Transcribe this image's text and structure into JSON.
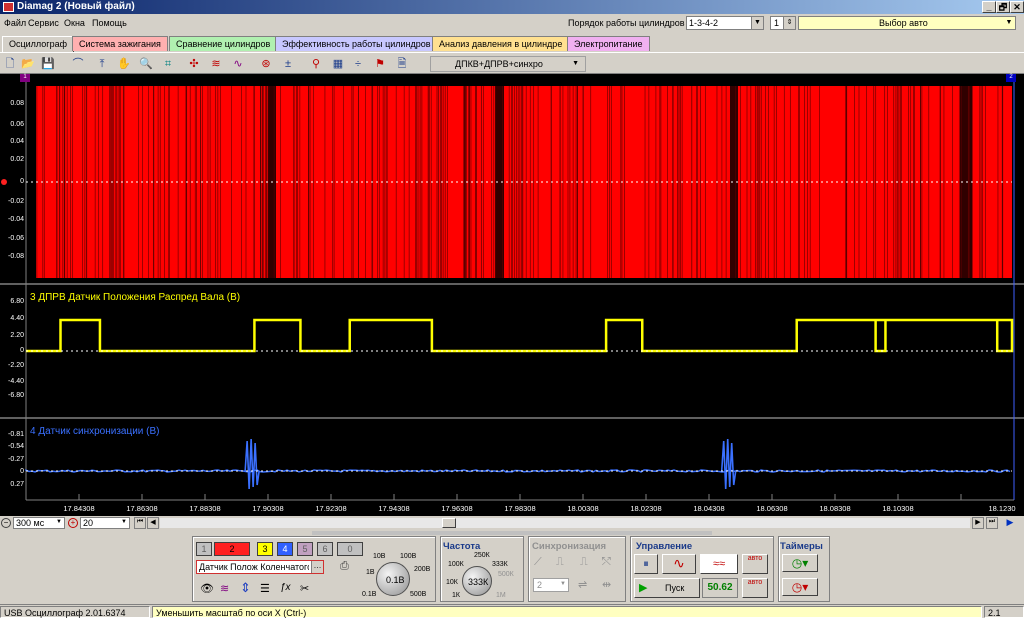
{
  "window": {
    "title": "Diamag 2 (Новый файл)",
    "controls": [
      "_",
      "🗗",
      "✕"
    ]
  },
  "menu": [
    "Файл",
    "Сервис",
    "Окна",
    "Помощь"
  ],
  "cylinder": {
    "label": "Порядок работы цилиндров",
    "order_value": "1-3-4-2",
    "spin_value": "1",
    "car_select": "Выбор авто"
  },
  "tabs": [
    {
      "label": "Осциллограф",
      "color": "#d4d0c8",
      "active": true
    },
    {
      "label": "Система зажигания",
      "color": "#ffb0b0"
    },
    {
      "label": "Сравнение цилиндров",
      "color": "#b0f0b0"
    },
    {
      "label": "Эффективность работы цилиндров",
      "color": "#c8c8ff"
    },
    {
      "label": "Анализ давления в цилиндре",
      "color": "#ffe090"
    },
    {
      "label": "Электропитание",
      "color": "#f0b0f0"
    }
  ],
  "toolbar": {
    "icons": [
      "new-file-icon",
      "open-folder-icon",
      "save-icon",
      "cursor-icon",
      "arrow-up-icon",
      "hand-icon",
      "zoom-icon",
      "grid-icon",
      "scale-x-icon",
      "wave-icon",
      "wave-icon",
      "auto-scale-icon",
      "offset-icon",
      "filter-icon",
      "table-icon",
      "marker-icon",
      "flag-icon",
      "document-icon"
    ],
    "mode_select": "ДПКВ+ДПРВ+синхро"
  },
  "channels": {
    "ch1": {
      "marker": "1",
      "yticks": [
        "0.08",
        "0.06",
        "0.04",
        "0.02",
        "0",
        "-0.02",
        "-0.04",
        "-0.06",
        "-0.08"
      ],
      "color": "#ff0000"
    },
    "ch3": {
      "label": "3 ДПРВ Датчик Положения Распред Вала (В)",
      "yticks": [
        "6.80",
        "4.40",
        "2.20",
        "0",
        "-2.20",
        "-4.40",
        "-6.80"
      ],
      "color": "#ffff00"
    },
    "ch4": {
      "label": "4 Датчик синхронизации (В)",
      "yticks": [
        "-0.81",
        "-0.54",
        "-0.27",
        "0",
        "0.27"
      ],
      "color": "#3a70ff"
    },
    "right_marker": "2"
  },
  "xaxis": {
    "ticks": [
      "17.84308",
      "17.86308",
      "17.88308",
      "17.90308",
      "17.92308",
      "17.94308",
      "17.96308",
      "17.98308",
      "18.00308",
      "18.02308",
      "18.04308",
      "18.06308",
      "18.08308",
      "18.10308",
      "18.1230"
    ]
  },
  "chart_data": {
    "type": "line",
    "x_range": [
      17.823,
      18.123
    ],
    "series": [
      {
        "channel": "1",
        "description_unit": "В",
        "y_range": [
          -0.09,
          0.09
        ]
      },
      {
        "channel": "3",
        "name": "3 ДПРВ Датчик Положения Распред Вала (В)",
        "high_level": 4.4,
        "low_level": 0,
        "high_intervals": [
          [
            17.8335,
            17.8455
          ],
          [
            17.8925,
            17.9065
          ],
          [
            17.9215,
            17.9465
          ],
          [
            17.9995,
            18.0105
          ],
          [
            18.0575,
            18.0845
          ],
          [
            18.0815,
            18.1305
          ],
          [
            18.1185,
            18.123
          ]
        ]
      },
      {
        "channel": "4",
        "name": "4 Датчик синхронизации (В)",
        "spikes_at": [
          17.8915,
          18.0365
        ]
      }
    ]
  },
  "bottom": {
    "timebase": "300 мс",
    "count": "20",
    "channel_buttons": [
      "1",
      "2",
      "3",
      "4",
      "5",
      "6",
      "0"
    ],
    "sensor_field": "Датчик Полож Коленчатого Ва",
    "volt_knob": {
      "center": "0.1В",
      "marks": [
        "10В",
        "100В",
        "1В",
        "200В",
        "0.1В",
        "500В"
      ]
    },
    "freq": {
      "title": "Частота",
      "center": "333К",
      "marks": [
        "250К",
        "100К",
        "333К",
        "500К",
        "10К",
        "1М",
        "1К"
      ]
    },
    "sync": {
      "title": "Синхронизация",
      "value": "2"
    },
    "control": {
      "title": "Управление",
      "start": "Пуск",
      "value": "50.62",
      "auto": "авто"
    },
    "timers": {
      "title": "Таймеры"
    }
  },
  "status": {
    "app": "USB Осциллограф  2.01.6374",
    "hint": "Уменьшить масштаб по оси X (Ctrl-)",
    "right": "2.1"
  }
}
